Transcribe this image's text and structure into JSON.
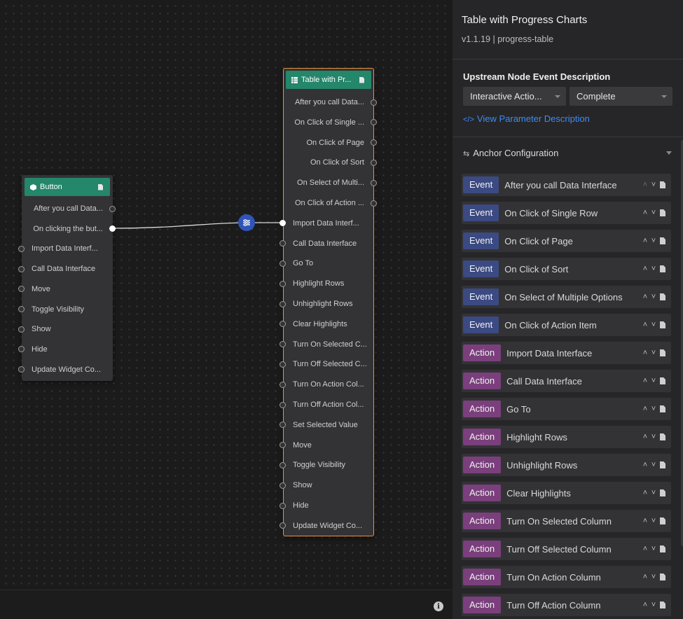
{
  "button_node": {
    "title": "Button",
    "ports": [
      {
        "label": "After you call Data...",
        "side": "out",
        "filled": false
      },
      {
        "label": "On clicking the but...",
        "side": "out",
        "filled": true
      },
      {
        "label": "Import Data Interf...",
        "side": "in",
        "filled": false
      },
      {
        "label": "Call Data Interface",
        "side": "in",
        "filled": false
      },
      {
        "label": "Move",
        "side": "in",
        "filled": false
      },
      {
        "label": "Toggle Visibility",
        "side": "in",
        "filled": false
      },
      {
        "label": "Show",
        "side": "in",
        "filled": false
      },
      {
        "label": "Hide",
        "side": "in",
        "filled": false
      },
      {
        "label": "Update Widget Co...",
        "side": "in",
        "filled": false
      }
    ]
  },
  "table_node": {
    "title": "Table with Pr...",
    "ports": [
      {
        "label": "After you call Data...",
        "side": "out",
        "filled": false
      },
      {
        "label": "On Click of Single ...",
        "side": "out",
        "filled": false
      },
      {
        "label": "On Click of Page",
        "side": "out",
        "filled": false
      },
      {
        "label": "On Click of Sort",
        "side": "out",
        "filled": false
      },
      {
        "label": "On Select of Multi...",
        "side": "out",
        "filled": false
      },
      {
        "label": "On Click of Action ...",
        "side": "out",
        "filled": false
      },
      {
        "label": "Import Data Interf...",
        "side": "in",
        "filled": true
      },
      {
        "label": "Call Data Interface",
        "side": "in",
        "filled": false
      },
      {
        "label": "Go To",
        "side": "in",
        "filled": false
      },
      {
        "label": "Highlight Rows",
        "side": "in",
        "filled": false
      },
      {
        "label": "Unhighlight Rows",
        "side": "in",
        "filled": false
      },
      {
        "label": "Clear Highlights",
        "side": "in",
        "filled": false
      },
      {
        "label": "Turn On Selected C...",
        "side": "in",
        "filled": false
      },
      {
        "label": "Turn Off Selected C...",
        "side": "in",
        "filled": false
      },
      {
        "label": "Turn On Action Col...",
        "side": "in",
        "filled": false
      },
      {
        "label": "Turn Off Action Col...",
        "side": "in",
        "filled": false
      },
      {
        "label": "Set Selected Value",
        "side": "in",
        "filled": false
      },
      {
        "label": "Move",
        "side": "in",
        "filled": false
      },
      {
        "label": "Toggle Visibility",
        "side": "in",
        "filled": false
      },
      {
        "label": "Show",
        "side": "in",
        "filled": false
      },
      {
        "label": "Hide",
        "side": "in",
        "filled": false
      },
      {
        "label": "Update Widget Co...",
        "side": "in",
        "filled": false
      }
    ]
  },
  "panel": {
    "title": "Table with Progress Charts",
    "subtitle": "v1.1.19 | progress-table",
    "upstream_heading": "Upstream Node Event Description",
    "select_event": "Interactive Actio...",
    "select_type": "Complete",
    "param_link": "View Parameter Description",
    "anchor_heading": "Anchor Configuration",
    "anchors": [
      {
        "type": "Event",
        "label": "After you call Data Interface"
      },
      {
        "type": "Event",
        "label": "On Click of Single Row"
      },
      {
        "type": "Event",
        "label": "On Click of Page"
      },
      {
        "type": "Event",
        "label": "On Click of Sort"
      },
      {
        "type": "Event",
        "label": "On Select of Multiple Options"
      },
      {
        "type": "Event",
        "label": "On Click of Action Item"
      },
      {
        "type": "Action",
        "label": "Import Data Interface"
      },
      {
        "type": "Action",
        "label": "Call Data Interface"
      },
      {
        "type": "Action",
        "label": "Go To"
      },
      {
        "type": "Action",
        "label": "Highlight Rows"
      },
      {
        "type": "Action",
        "label": "Unhighlight Rows"
      },
      {
        "type": "Action",
        "label": "Clear Highlights"
      },
      {
        "type": "Action",
        "label": "Turn On Selected Column"
      },
      {
        "type": "Action",
        "label": "Turn Off Selected Column"
      },
      {
        "type": "Action",
        "label": "Turn On Action Column"
      },
      {
        "type": "Action",
        "label": "Turn Off Action Column"
      }
    ]
  }
}
